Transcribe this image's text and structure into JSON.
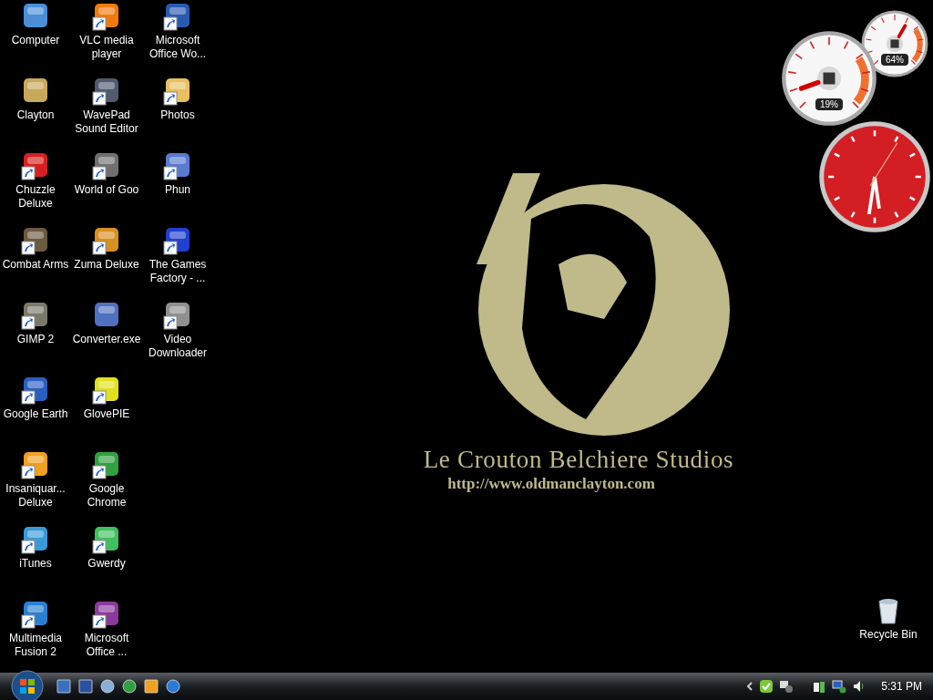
{
  "desktop_icons": [
    {
      "label": "Computer",
      "shortcut": false
    },
    {
      "label": "Clayton",
      "shortcut": false
    },
    {
      "label": "Chuzzle Deluxe",
      "shortcut": true
    },
    {
      "label": "Combat Arms",
      "shortcut": true
    },
    {
      "label": "GIMP 2",
      "shortcut": true
    },
    {
      "label": "Google Earth",
      "shortcut": true
    },
    {
      "label": "Insaniquar... Deluxe",
      "shortcut": true
    },
    {
      "label": "iTunes",
      "shortcut": true
    },
    {
      "label": "Multimedia Fusion 2",
      "shortcut": true
    },
    {
      "label": "VLC media player",
      "shortcut": true
    },
    {
      "label": "WavePad Sound Editor",
      "shortcut": true
    },
    {
      "label": "World of Goo",
      "shortcut": true
    },
    {
      "label": "Zuma Deluxe",
      "shortcut": true
    },
    {
      "label": "Converter.exe",
      "shortcut": false
    },
    {
      "label": "GlovePIE",
      "shortcut": true
    },
    {
      "label": "Google Chrome",
      "shortcut": true
    },
    {
      "label": "Gwerdy",
      "shortcut": true
    },
    {
      "label": "Microsoft Office ...",
      "shortcut": true
    },
    {
      "label": "Microsoft Office Wo...",
      "shortcut": true
    },
    {
      "label": "Photos",
      "shortcut": true
    },
    {
      "label": "Phun",
      "shortcut": true
    },
    {
      "label": "The Games Factory - ...",
      "shortcut": true
    },
    {
      "label": "Video Downloader",
      "shortcut": true
    }
  ],
  "recycle_bin": {
    "label": "Recycle Bin"
  },
  "wallpaper": {
    "title": "Le Crouton Belchiere Studios",
    "url": "http://www.oldmanclayton.com"
  },
  "gadgets": {
    "cpu_meter": [
      {
        "reading": "19%"
      },
      {
        "reading": "64%"
      }
    ]
  },
  "taskbar": {
    "clock": "5:31 PM"
  }
}
